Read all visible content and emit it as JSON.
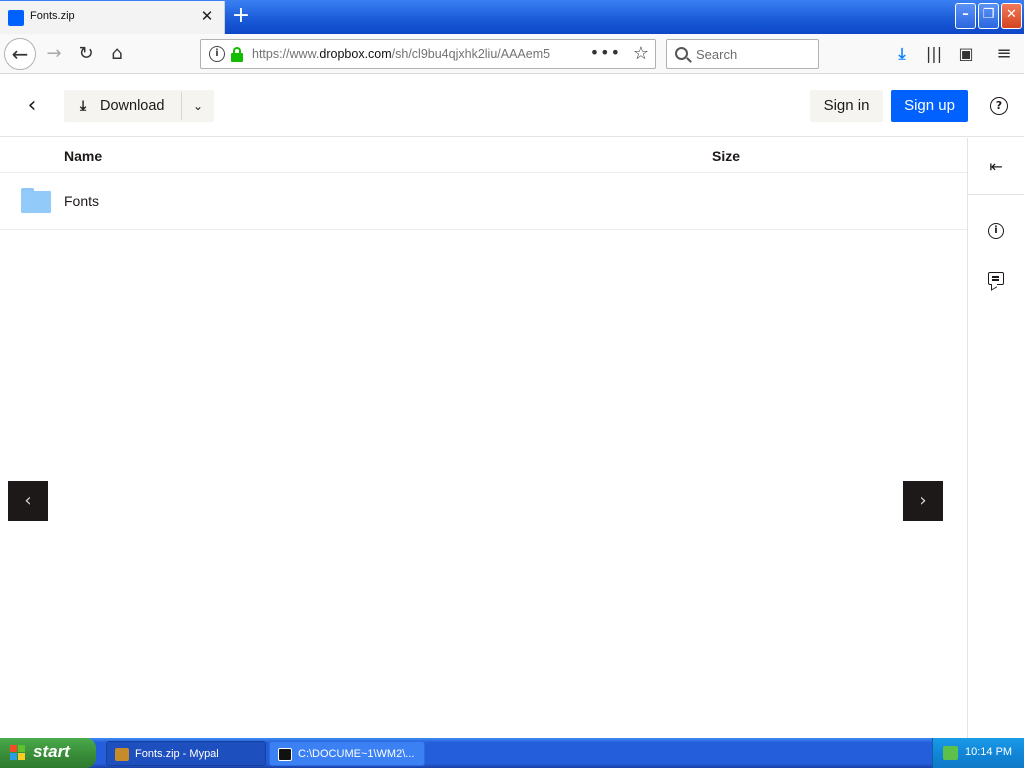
{
  "browser": {
    "tab": {
      "title": "Fonts.zip",
      "close_glyph": "✕"
    },
    "new_tab_glyph": "+",
    "window_controls": {
      "minimize": "–",
      "maximize": "❐",
      "close": "✕"
    },
    "nav": {
      "back": "←",
      "forward": "→",
      "reload": "↻",
      "home": "⌂"
    },
    "url": {
      "prefix": "https://www.",
      "domain": "dropbox.com",
      "path": "/sh/cl9bu4qjxhk2liu/AAAem5",
      "more": "•••",
      "star": "☆"
    },
    "search": {
      "placeholder": "Search"
    },
    "toolbar": {
      "download": "⤓",
      "library": "|||",
      "sidebar": "▣",
      "menu": "≡"
    }
  },
  "dropbox": {
    "back_glyph": "‹",
    "download": {
      "icon": "⤓",
      "label": "Download",
      "caret": "⌄"
    },
    "signin": "Sign in",
    "signup": "Sign up",
    "help": "?",
    "columns": {
      "name": "Name",
      "size": "Size"
    },
    "files": [
      {
        "name": "Fonts",
        "type": "folder",
        "size": ""
      }
    ],
    "rail": {
      "collapse": "⇤",
      "info": "i"
    },
    "prev_glyph": "‹",
    "next_glyph": "›"
  },
  "taskbar": {
    "start": "start",
    "tasks": [
      {
        "label": "Fonts.zip - Mypal"
      },
      {
        "label": "C:\\DOCUME~1\\WM2\\..."
      }
    ],
    "clock": "10:14 PM"
  },
  "colors": {
    "accent": "#0061fe",
    "folder": "#92cbfa",
    "dark": "#1e1919"
  }
}
